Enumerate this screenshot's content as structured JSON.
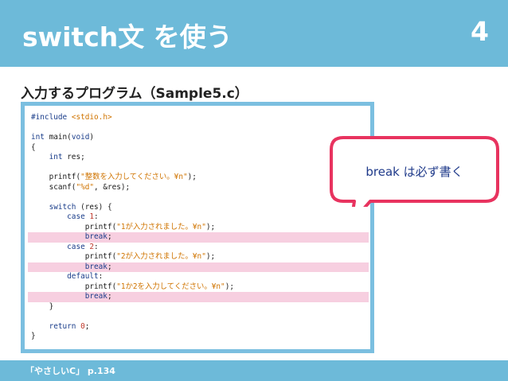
{
  "slide": {
    "title": "switch文 を使う",
    "number": "4",
    "subtitle": "入力するプログラム（Sample5.c）",
    "footer": "「やさしいC」 p.134",
    "bubble_text": "break は必ず書く",
    "colors": {
      "header": "#6dbad9",
      "code_border": "#7bbfe0",
      "highlight": "#f7cfe0",
      "bubble_border": "#e8335f",
      "bubble_text": "#1f3a8a"
    }
  },
  "code": [
    {
      "text": "#include <stdio.h>",
      "hl": false
    },
    {
      "text": "",
      "hl": false
    },
    {
      "text": "int main(void)",
      "hl": false
    },
    {
      "text": "{",
      "hl": false
    },
    {
      "text": "    int res;",
      "hl": false
    },
    {
      "text": "",
      "hl": false
    },
    {
      "text": "    printf(\"整数を入力してください。¥n\");",
      "hl": false
    },
    {
      "text": "    scanf(\"%d\", &res);",
      "hl": false
    },
    {
      "text": "",
      "hl": false
    },
    {
      "text": "    switch (res) {",
      "hl": false
    },
    {
      "text": "        case 1:",
      "hl": false
    },
    {
      "text": "            printf(\"1が入力されました。¥n\");",
      "hl": false
    },
    {
      "text": "            break;",
      "hl": true
    },
    {
      "text": "        case 2:",
      "hl": false
    },
    {
      "text": "            printf(\"2が入力されました。¥n\");",
      "hl": false
    },
    {
      "text": "            break;",
      "hl": true
    },
    {
      "text": "        default:",
      "hl": false
    },
    {
      "text": "            printf(\"1か2を入力してください。¥n\");",
      "hl": false
    },
    {
      "text": "            break;",
      "hl": true
    },
    {
      "text": "    }",
      "hl": false
    },
    {
      "text": "",
      "hl": false
    },
    {
      "text": "    return 0;",
      "hl": false
    },
    {
      "text": "}",
      "hl": false
    }
  ]
}
